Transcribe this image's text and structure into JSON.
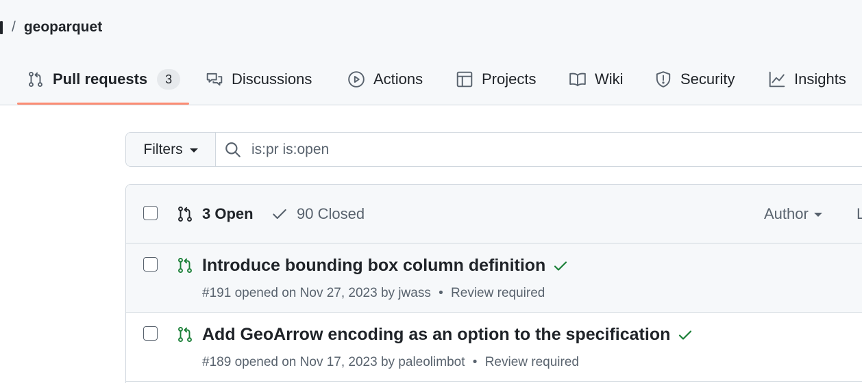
{
  "breadcrumb": {
    "separator": "/",
    "repo": "geoparquet"
  },
  "tabs": [
    {
      "label": "Pull requests",
      "count": "3",
      "icon": "git-pull-request-icon",
      "active": true
    },
    {
      "label": "Discussions",
      "icon": "comment-discussion-icon"
    },
    {
      "label": "Actions",
      "icon": "play-icon"
    },
    {
      "label": "Projects",
      "icon": "table-icon"
    },
    {
      "label": "Wiki",
      "icon": "book-icon"
    },
    {
      "label": "Security",
      "icon": "shield-icon"
    },
    {
      "label": "Insights",
      "icon": "graph-icon"
    }
  ],
  "filters": {
    "button_label": "Filters",
    "query": "is:pr is:open"
  },
  "list_header": {
    "open_label": "3 Open",
    "closed_label": "90 Closed",
    "author_label": "Author",
    "next_label_fragment": "L"
  },
  "pull_requests": [
    {
      "title": "Introduce bounding box column definition",
      "number": "#191",
      "opened": "opened on Nov 27, 2023 by jwass",
      "separator": "•",
      "review": "Review required"
    },
    {
      "title": "Add GeoArrow encoding as an option to the specification",
      "number": "#189",
      "opened": "opened on Nov 17, 2023 by paleolimbot",
      "separator": "•",
      "review": "Review required"
    }
  ],
  "colors": {
    "accent_underline": "#fd8c73",
    "open_green": "#1a7f37",
    "muted": "#59636e",
    "border": "#d0d7de"
  }
}
